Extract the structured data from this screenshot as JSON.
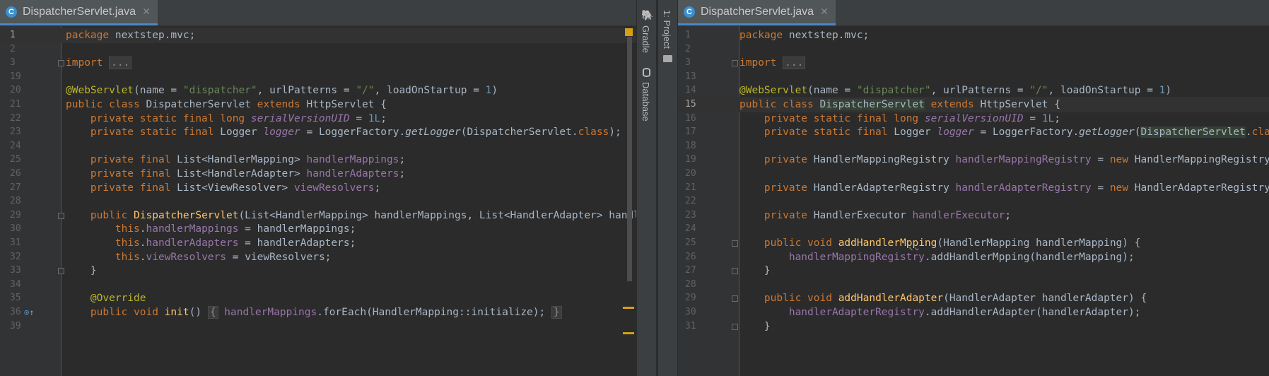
{
  "left": {
    "tab": {
      "icon_letter": "C",
      "title": "DispatcherServlet.java",
      "close": "✕"
    },
    "lines": [
      {
        "n": "1",
        "html": "<span class=\"kw\">package</span> nextstep.mvc;",
        "cur": true
      },
      {
        "n": "2",
        "html": ""
      },
      {
        "n": "3",
        "html": "<span class=\"kw\">import</span> <span class=\"fold\">...</span>",
        "fold": true
      },
      {
        "n": "19",
        "html": ""
      },
      {
        "n": "20",
        "html": "<span class=\"an\">@WebServlet</span>(name = <span class=\"st\">\"dispatcher\"</span>, urlPatterns = <span class=\"st\">\"/\"</span>, loadOnStartup = <span class=\"nu\">1</span>)"
      },
      {
        "n": "21",
        "html": "<span class=\"kw\">public class</span> DispatcherServlet <span class=\"kw\">extends</span> HttpServlet {"
      },
      {
        "n": "22",
        "html": "    <span class=\"kw\">private static final long</span> <span class=\"fdi\">serialVersionUID</span> = <span class=\"nu\">1L</span>;"
      },
      {
        "n": "23",
        "html": "    <span class=\"kw\">private static final</span> Logger <span class=\"fdi\">logger</span> = LoggerFactory.<span class=\"mi\">getLogger</span>(DispatcherServlet.<span class=\"kw\">class</span>);"
      },
      {
        "n": "24",
        "html": ""
      },
      {
        "n": "25",
        "html": "    <span class=\"kw\">private final</span> List&lt;HandlerMapping&gt; <span class=\"fd\">handlerMappings</span>;"
      },
      {
        "n": "26",
        "html": "    <span class=\"kw\">private final</span> List&lt;HandlerAdapter&gt; <span class=\"fd\">handlerAdapters</span>;"
      },
      {
        "n": "27",
        "html": "    <span class=\"kw\">private final</span> List&lt;ViewResolver&gt; <span class=\"fd\">viewResolvers</span>;"
      },
      {
        "n": "28",
        "html": ""
      },
      {
        "n": "29",
        "html": "    <span class=\"kw\">public</span> <span class=\"md\">DispatcherServlet</span>(List&lt;HandlerMapping&gt; handlerMappings, List&lt;HandlerAdapter&gt; handlerAdapte",
        "fold": true
      },
      {
        "n": "30",
        "html": "        <span class=\"kw\">this</span>.<span class=\"fd\">handlerMappings</span> = handlerMappings;"
      },
      {
        "n": "31",
        "html": "        <span class=\"kw\">this</span>.<span class=\"fd\">handlerAdapters</span> = handlerAdapters;"
      },
      {
        "n": "32",
        "html": "        <span class=\"kw\">this</span>.<span class=\"fd\">viewResolvers</span> = viewResolvers;"
      },
      {
        "n": "33",
        "html": "    }",
        "fold": true
      },
      {
        "n": "34",
        "html": ""
      },
      {
        "n": "35",
        "html": "    <span class=\"an\">@Override</span>"
      },
      {
        "n": "36",
        "html": "    <span class=\"kw\">public void</span> <span class=\"md\">init</span>() <span class=\"fold\">{</span> <span class=\"fd\">handlerMappings</span>.forEach(HandlerMapping::initialize); <span class=\"fold\">}</span>",
        "gutter_icon": true
      },
      {
        "n": "39",
        "html": ""
      }
    ]
  },
  "sidebar_left": {
    "gradle": "Gradle",
    "database": "Database"
  },
  "sidebar_right": {
    "project": "1: Project"
  },
  "right": {
    "tab": {
      "icon_letter": "C",
      "title": "DispatcherServlet.java",
      "close": "✕"
    },
    "lines": [
      {
        "n": "1",
        "html": "<span class=\"kw\">package</span> nextstep.mvc;"
      },
      {
        "n": "2",
        "html": ""
      },
      {
        "n": "3",
        "html": "<span class=\"kw\">import</span> <span class=\"fold\">...</span>",
        "fold": true
      },
      {
        "n": "13",
        "html": ""
      },
      {
        "n": "14",
        "html": "<span class=\"an\">@WebServlet</span>(name = <span class=\"st\">\"dispatcher\"</span>, urlPatterns = <span class=\"st\">\"/\"</span>, loadOnStartup = <span class=\"nu\">1</span>)"
      },
      {
        "n": "15",
        "html": "<span class=\"kw\">public class</span> <span class=\"hl\">DispatcherServlet</span> <span class=\"kw\">extends</span> HttpServlet {",
        "cur": true
      },
      {
        "n": "16",
        "html": "    <span class=\"kw\">private static final long</span> <span class=\"fdi\">serialVersionUID</span> = <span class=\"nu\">1L</span>;"
      },
      {
        "n": "17",
        "html": "    <span class=\"kw\">private static final</span> Logger <span class=\"fdi\">logger</span> = LoggerFactory.<span class=\"mi\">getLogger</span>(<span class=\"hl\">DispatcherServlet</span>.<span class=\"kw\">class</span>);"
      },
      {
        "n": "18",
        "html": ""
      },
      {
        "n": "19",
        "html": "    <span class=\"kw\">private</span> HandlerMappingRegistry <span class=\"fd\">handlerMappingRegistry</span> = <span class=\"kw\">new</span> HandlerMappingRegistry();"
      },
      {
        "n": "20",
        "html": ""
      },
      {
        "n": "21",
        "html": "    <span class=\"kw\">private</span> HandlerAdapterRegistry <span class=\"fd\">handlerAdapterRegistry</span> = <span class=\"kw\">new</span> HandlerAdapterRegistry();"
      },
      {
        "n": "22",
        "html": ""
      },
      {
        "n": "23",
        "html": "    <span class=\"kw\">private</span> HandlerExecutor <span class=\"fd\">handlerExecutor</span>;"
      },
      {
        "n": "24",
        "html": ""
      },
      {
        "n": "25",
        "html": "    <span class=\"kw\">public void</span> <span class=\"md\">addHandlerM<span class=\"ul\">pp</span>ing</span>(HandlerMapping handlerMapping) {",
        "fold": true
      },
      {
        "n": "26",
        "html": "        <span class=\"fd\">handlerMappingRegistry</span>.addHandlerMpping(handlerMapping);"
      },
      {
        "n": "27",
        "html": "    }",
        "fold": true
      },
      {
        "n": "28",
        "html": ""
      },
      {
        "n": "29",
        "html": "    <span class=\"kw\">public void</span> <span class=\"md\">addHandlerAdapter</span>(HandlerAdapter handlerAdapter) {",
        "fold": true
      },
      {
        "n": "30",
        "html": "        <span class=\"fd\">handlerAdapterRegistry</span>.addHandlerAdapter(handlerAdapter);"
      },
      {
        "n": "31",
        "html": "    }",
        "fold": true
      }
    ]
  }
}
